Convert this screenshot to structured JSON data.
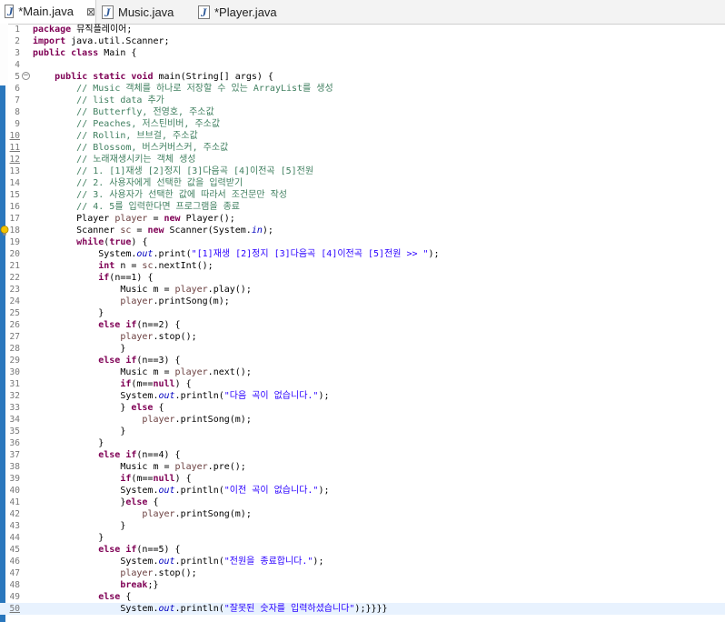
{
  "tabs": [
    {
      "label": "*Main.java",
      "close": "⊠"
    },
    {
      "label": "Music.java"
    },
    {
      "label": "*Player.java"
    }
  ],
  "colors": {
    "keyword": "#7f0055",
    "comment": "#3f7f5f",
    "string": "#2a00ff",
    "marker": "#2a77bd",
    "current_line": "#e8f2fe"
  },
  "icons": {
    "java_file": "java-file-icon",
    "fold": "fold-collapse-icon",
    "warning": "warning-lightbulb-icon"
  },
  "editor": {
    "current_line": 50,
    "lines": [
      {
        "n": "1",
        "s": [
          {
            "t": "package",
            "c": "kw"
          },
          {
            "t": " 뮤직플레이어;"
          }
        ]
      },
      {
        "n": "2",
        "s": [
          {
            "t": "import",
            "c": "kw"
          },
          {
            "t": " java.util.Scanner;"
          }
        ]
      },
      {
        "n": "3",
        "s": [
          {
            "t": "public class",
            "c": "kw"
          },
          {
            "t": " Main {"
          }
        ]
      },
      {
        "n": "4",
        "s": []
      },
      {
        "n": "5",
        "s": [
          {
            "t": "    "
          },
          {
            "t": "public static void",
            "c": "kw"
          },
          {
            "t": " main(String[] args) {"
          }
        ]
      },
      {
        "n": "6",
        "s": [
          {
            "t": "        "
          },
          {
            "t": "// Music 객체를 하나로 저장할 수 있는 ArrayList를 생성",
            "c": "cm"
          }
        ]
      },
      {
        "n": "7",
        "s": [
          {
            "t": "        "
          },
          {
            "t": "// list data 추가",
            "c": "cm"
          }
        ]
      },
      {
        "n": "8",
        "s": [
          {
            "t": "        "
          },
          {
            "t": "// Butterfly, 전영호, 주소값",
            "c": "cm"
          }
        ]
      },
      {
        "n": "9",
        "s": [
          {
            "t": "        "
          },
          {
            "t": "// Peaches, 저스틴비버, 주소값",
            "c": "cm"
          }
        ]
      },
      {
        "n": "10",
        "s": [
          {
            "t": "        "
          },
          {
            "t": "// Rollin, 브브걸, 주소값",
            "c": "cm"
          }
        ]
      },
      {
        "n": "11",
        "s": [
          {
            "t": "        "
          },
          {
            "t": "// Blossom, 버스커버스커, 주소값",
            "c": "cm"
          }
        ]
      },
      {
        "n": "12",
        "s": [
          {
            "t": "        "
          },
          {
            "t": "// 노래재생시키는 객체 생성",
            "c": "cm"
          }
        ]
      },
      {
        "n": "13",
        "s": [
          {
            "t": "        "
          },
          {
            "t": "// 1. [1]재생 [2]정지 [3]다음곡 [4]이전곡 [5]전원",
            "c": "cm"
          }
        ]
      },
      {
        "n": "14",
        "s": [
          {
            "t": "        "
          },
          {
            "t": "// 2. 사용자에게 선택한 값을 입력받기",
            "c": "cm"
          }
        ]
      },
      {
        "n": "15",
        "s": [
          {
            "t": "        "
          },
          {
            "t": "// 3. 사용자가 선택한 값에 따라서 조건문만 작성",
            "c": "cm"
          }
        ]
      },
      {
        "n": "16",
        "s": [
          {
            "t": "        "
          },
          {
            "t": "// 4. 5를 입력한다면 프로그램을 종료",
            "c": "cm"
          }
        ]
      },
      {
        "n": "17",
        "s": [
          {
            "t": "        Player "
          },
          {
            "t": "player",
            "c": "vr"
          },
          {
            "t": " = "
          },
          {
            "t": "new",
            "c": "kw"
          },
          {
            "t": " Player();"
          }
        ]
      },
      {
        "n": "18",
        "s": [
          {
            "t": "        Scanner "
          },
          {
            "t": "sc",
            "c": "vr"
          },
          {
            "t": " = "
          },
          {
            "t": "new",
            "c": "kw"
          },
          {
            "t": " Scanner(System."
          },
          {
            "t": "in",
            "c": "fd"
          },
          {
            "t": ");"
          }
        ]
      },
      {
        "n": "19",
        "s": [
          {
            "t": "        "
          },
          {
            "t": "while",
            "c": "kw"
          },
          {
            "t": "("
          },
          {
            "t": "true",
            "c": "kw"
          },
          {
            "t": ") {"
          }
        ]
      },
      {
        "n": "20",
        "s": [
          {
            "t": "            System."
          },
          {
            "t": "out",
            "c": "fd"
          },
          {
            "t": ".print("
          },
          {
            "t": "\"[1]재생 [2]정지 [3]다음곡 [4]이전곡 [5]전원 >> \"",
            "c": "st"
          },
          {
            "t": ");"
          }
        ]
      },
      {
        "n": "21",
        "s": [
          {
            "t": "            "
          },
          {
            "t": "int",
            "c": "kw"
          },
          {
            "t": " n = "
          },
          {
            "t": "sc",
            "c": "vr"
          },
          {
            "t": ".nextInt();"
          }
        ]
      },
      {
        "n": "22",
        "s": [
          {
            "t": "            "
          },
          {
            "t": "if",
            "c": "kw"
          },
          {
            "t": "(n==1) {"
          }
        ]
      },
      {
        "n": "23",
        "s": [
          {
            "t": "                Music m = "
          },
          {
            "t": "player",
            "c": "vr"
          },
          {
            "t": ".play();"
          }
        ]
      },
      {
        "n": "24",
        "s": [
          {
            "t": "                "
          },
          {
            "t": "player",
            "c": "vr"
          },
          {
            "t": ".printSong(m);"
          }
        ]
      },
      {
        "n": "25",
        "s": [
          {
            "t": "            }"
          }
        ]
      },
      {
        "n": "26",
        "s": [
          {
            "t": "            "
          },
          {
            "t": "else if",
            "c": "kw"
          },
          {
            "t": "(n==2) {"
          }
        ]
      },
      {
        "n": "27",
        "s": [
          {
            "t": "                "
          },
          {
            "t": "player",
            "c": "vr"
          },
          {
            "t": ".stop();"
          }
        ]
      },
      {
        "n": "28",
        "s": [
          {
            "t": "                }"
          }
        ]
      },
      {
        "n": "29",
        "s": [
          {
            "t": "            "
          },
          {
            "t": "else if",
            "c": "kw"
          },
          {
            "t": "(n==3) {"
          }
        ]
      },
      {
        "n": "30",
        "s": [
          {
            "t": "                Music m = "
          },
          {
            "t": "player",
            "c": "vr"
          },
          {
            "t": ".next();"
          }
        ]
      },
      {
        "n": "31",
        "s": [
          {
            "t": "                "
          },
          {
            "t": "if",
            "c": "kw"
          },
          {
            "t": "(m=="
          },
          {
            "t": "null",
            "c": "kw"
          },
          {
            "t": ") {"
          }
        ]
      },
      {
        "n": "32",
        "s": [
          {
            "t": "                System."
          },
          {
            "t": "out",
            "c": "fd"
          },
          {
            "t": ".println("
          },
          {
            "t": "\"다음 곡이 없습니다.\"",
            "c": "st"
          },
          {
            "t": ");"
          }
        ]
      },
      {
        "n": "33",
        "s": [
          {
            "t": "                } "
          },
          {
            "t": "else",
            "c": "kw"
          },
          {
            "t": " {"
          }
        ]
      },
      {
        "n": "34",
        "s": [
          {
            "t": "                    "
          },
          {
            "t": "player",
            "c": "vr"
          },
          {
            "t": ".printSong(m);"
          }
        ]
      },
      {
        "n": "35",
        "s": [
          {
            "t": "                }"
          }
        ]
      },
      {
        "n": "36",
        "s": [
          {
            "t": "            }"
          }
        ]
      },
      {
        "n": "37",
        "s": [
          {
            "t": "            "
          },
          {
            "t": "else if",
            "c": "kw"
          },
          {
            "t": "(n==4) {"
          }
        ]
      },
      {
        "n": "38",
        "s": [
          {
            "t": "                Music m = "
          },
          {
            "t": "player",
            "c": "vr"
          },
          {
            "t": ".pre();"
          }
        ]
      },
      {
        "n": "39",
        "s": [
          {
            "t": "                "
          },
          {
            "t": "if",
            "c": "kw"
          },
          {
            "t": "(m=="
          },
          {
            "t": "null",
            "c": "kw"
          },
          {
            "t": ") {"
          }
        ]
      },
      {
        "n": "40",
        "s": [
          {
            "t": "                System."
          },
          {
            "t": "out",
            "c": "fd"
          },
          {
            "t": ".println("
          },
          {
            "t": "\"이전 곡이 없습니다.\"",
            "c": "st"
          },
          {
            "t": ");"
          }
        ]
      },
      {
        "n": "41",
        "s": [
          {
            "t": "                }"
          },
          {
            "t": "else",
            "c": "kw"
          },
          {
            "t": " {"
          }
        ]
      },
      {
        "n": "42",
        "s": [
          {
            "t": "                    "
          },
          {
            "t": "player",
            "c": "vr"
          },
          {
            "t": ".printSong(m);"
          }
        ]
      },
      {
        "n": "43",
        "s": [
          {
            "t": "                }"
          }
        ]
      },
      {
        "n": "44",
        "s": [
          {
            "t": "            }"
          }
        ]
      },
      {
        "n": "45",
        "s": [
          {
            "t": "            "
          },
          {
            "t": "else if",
            "c": "kw"
          },
          {
            "t": "(n==5) {"
          }
        ]
      },
      {
        "n": "46",
        "s": [
          {
            "t": "                System."
          },
          {
            "t": "out",
            "c": "fd"
          },
          {
            "t": ".println("
          },
          {
            "t": "\"전원을 종료합니다.\"",
            "c": "st"
          },
          {
            "t": ");"
          }
        ]
      },
      {
        "n": "47",
        "s": [
          {
            "t": "                "
          },
          {
            "t": "player",
            "c": "vr"
          },
          {
            "t": ".stop();"
          }
        ]
      },
      {
        "n": "48",
        "s": [
          {
            "t": "                "
          },
          {
            "t": "break",
            "c": "kw"
          },
          {
            "t": ";}"
          }
        ]
      },
      {
        "n": "49",
        "s": [
          {
            "t": "            "
          },
          {
            "t": "else",
            "c": "kw"
          },
          {
            "t": " {"
          }
        ]
      },
      {
        "n": "50",
        "s": [
          {
            "t": "                System."
          },
          {
            "t": "out",
            "c": "fd"
          },
          {
            "t": ".println("
          },
          {
            "t": "\"잘못된 숫자를 입력하셨습니다\"",
            "c": "st"
          },
          {
            "t": ");}}}}"
          }
        ]
      }
    ]
  }
}
